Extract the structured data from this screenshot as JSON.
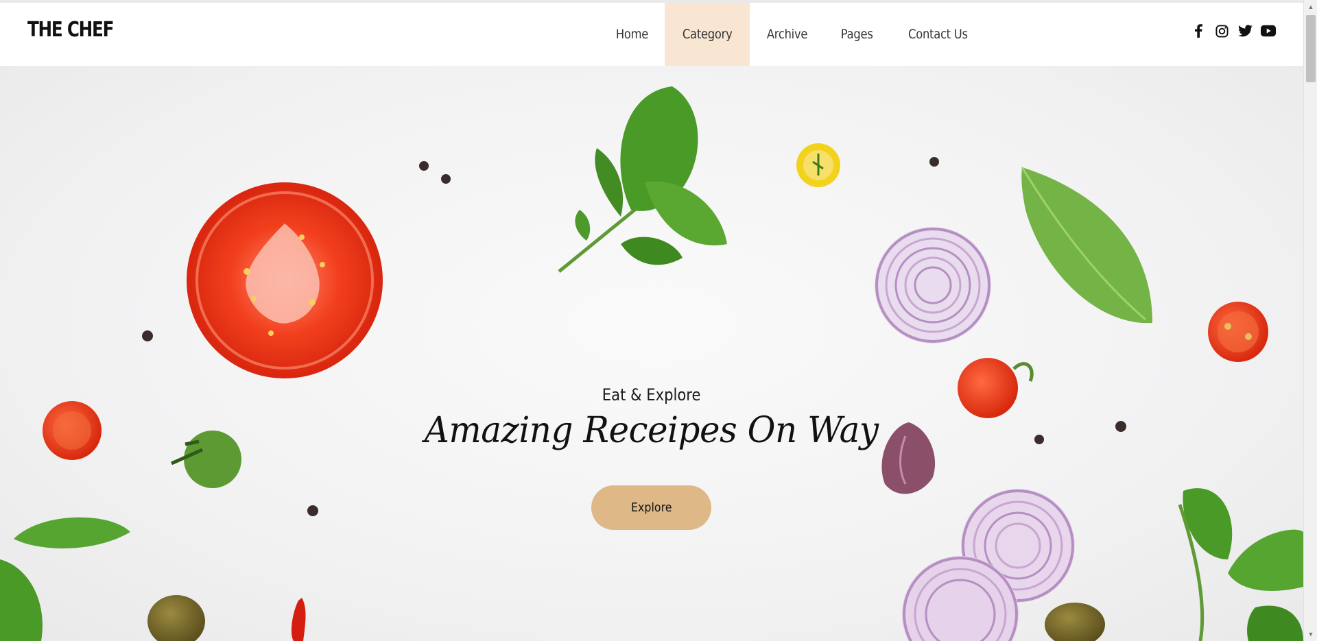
{
  "brand": {
    "logo_text": "THE CHEF"
  },
  "nav": {
    "items": [
      {
        "label": "Home",
        "active": false
      },
      {
        "label": "Category",
        "active": true
      },
      {
        "label": "Archive",
        "active": false
      },
      {
        "label": "Pages",
        "active": false
      },
      {
        "label": "Contact Us",
        "active": false
      }
    ],
    "active_bg": "#f8e6d3"
  },
  "social": {
    "icons": [
      "facebook-icon",
      "instagram-icon",
      "twitter-icon",
      "youtube-icon"
    ]
  },
  "hero": {
    "kicker": "Eat & Explore",
    "headline": "Amazing Receipes On Way",
    "button_label": "Explore",
    "button_color": "#dfb888"
  },
  "scrollbar": {
    "up_icon": "scroll-up-arrow-icon",
    "down_icon": "scroll-down-arrow-icon"
  }
}
